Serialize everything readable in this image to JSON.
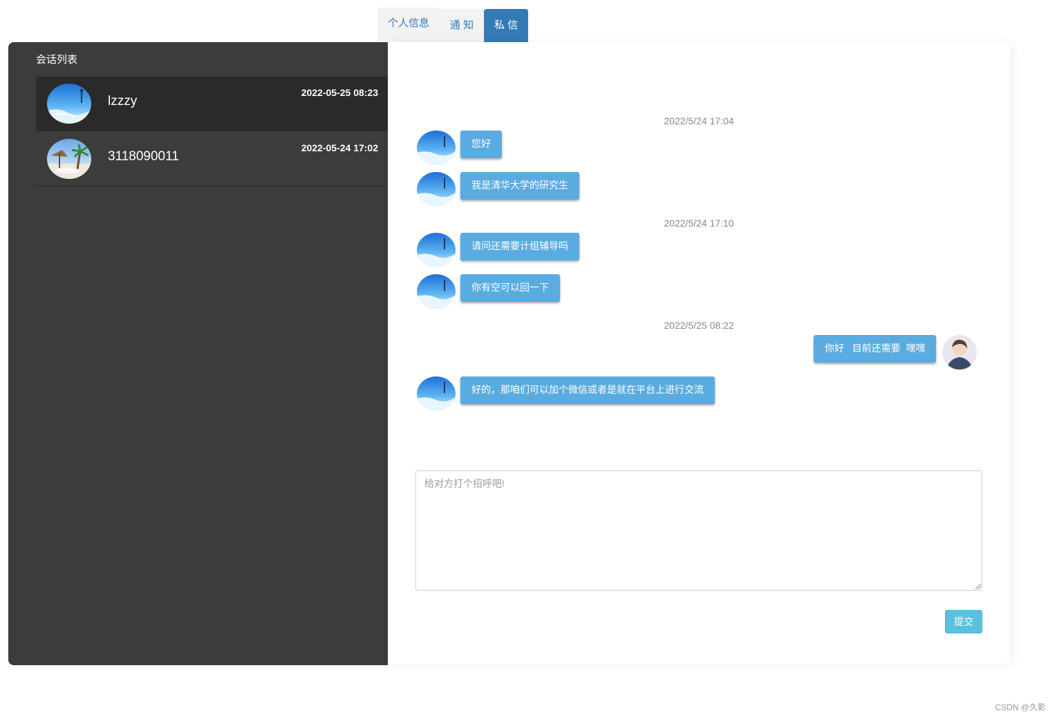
{
  "tabs": [
    {
      "label": "个人信息"
    },
    {
      "label": "通 知"
    },
    {
      "label": "私 信",
      "active": true
    }
  ],
  "conversation_list": {
    "title": "会话列表",
    "items": [
      {
        "name": "lzzzy",
        "time": "2022-05-25 08:23",
        "active": true
      },
      {
        "name": "3118090011",
        "time": "2022-05-24 17:02",
        "active": false
      }
    ]
  },
  "chat": {
    "timestamps": [
      "2022/5/24 17:04",
      "2022/5/24 17:10",
      "2022/5/25 08:22"
    ],
    "messages": [
      {
        "from": "other",
        "text": "您好"
      },
      {
        "from": "other",
        "text": "我是清华大学的研究生"
      },
      {
        "from": "other",
        "text": "请问还需要计组辅导吗"
      },
      {
        "from": "other",
        "text": "你有空可以回一下"
      },
      {
        "from": "me",
        "text": "你好   目前还需要  嘿嘿"
      },
      {
        "from": "other",
        "text": "好的，那咱们可以加个微信或者是就在平台上进行交流"
      }
    ],
    "input": {
      "placeholder": "给对方打个招呼吧!",
      "value": ""
    },
    "submit_label": "提交"
  },
  "footer": {
    "watermark": "CSDN @久影"
  },
  "colors": {
    "tab_active": "#337ab7",
    "left_panel": "#3c3c3c",
    "bubble": "#5aace0",
    "submit": "#5bc0de"
  }
}
